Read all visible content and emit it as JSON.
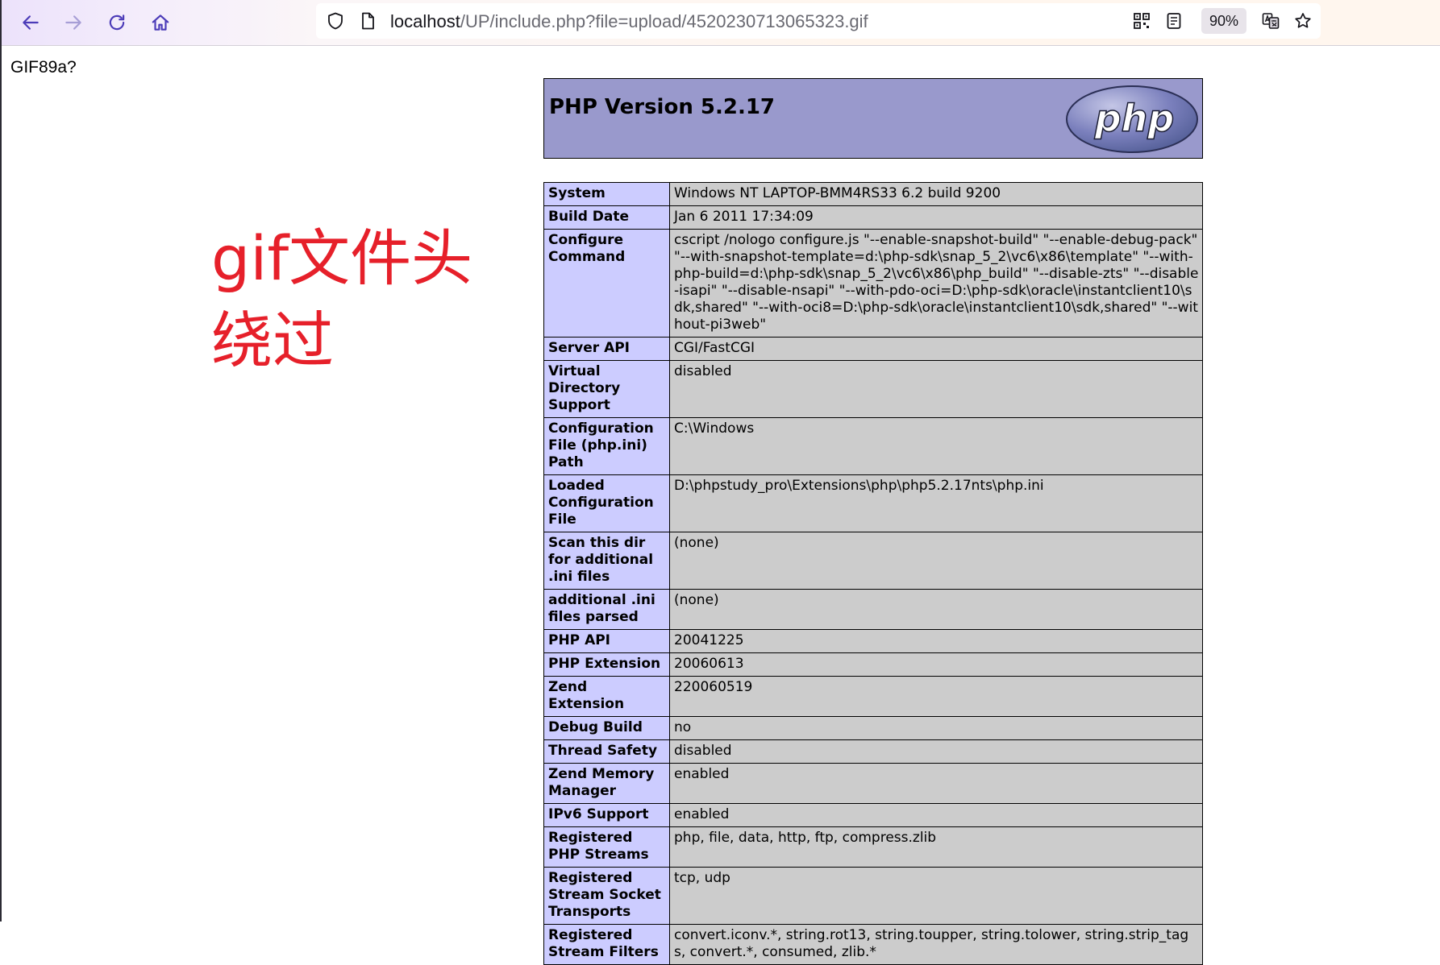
{
  "browser": {
    "url_host": "localhost",
    "url_path": "/UP/include.php?file=upload/4520230713065323.gif",
    "zoom": "90%",
    "icons": [
      "back-arrow-icon",
      "forward-arrow-icon",
      "reload-icon",
      "home-icon",
      "shield-icon",
      "page-icon",
      "qr-code-icon",
      "reader-view-icon",
      "translate-icon",
      "bookmark-star-icon"
    ]
  },
  "page": {
    "gif_header": "GIF89a?",
    "annotation": "gif文件头绕过"
  },
  "phpinfo": {
    "title": "PHP Version 5.2.17",
    "logo_text": "php",
    "colors": {
      "header_bg": "#9999cc",
      "key_bg": "#ccccff",
      "value_bg": "#cccccc"
    },
    "rows": [
      {
        "key": "System",
        "value": "Windows NT LAPTOP-BMM4RS33 6.2 build 9200"
      },
      {
        "key": "Build Date",
        "value": "Jan 6 2011 17:34:09"
      },
      {
        "key": "Configure Command",
        "value": "cscript /nologo configure.js \"--enable-snapshot-build\" \"--enable-debug-pack\" \"--with-snapshot-template=d:\\php-sdk\\snap_5_2\\vc6\\x86\\template\" \"--with-php-build=d:\\php-sdk\\snap_5_2\\vc6\\x86\\php_build\" \"--disable-zts\" \"--disable-isapi\" \"--disable-nsapi\" \"--with-pdo-oci=D:\\php-sdk\\oracle\\instantclient10\\sdk,shared\" \"--with-oci8=D:\\php-sdk\\oracle\\instantclient10\\sdk,shared\" \"--without-pi3web\""
      },
      {
        "key": "Server API",
        "value": "CGI/FastCGI"
      },
      {
        "key": "Virtual Directory Support",
        "value": "disabled"
      },
      {
        "key": "Configuration File (php.ini) Path",
        "value": "C:\\Windows"
      },
      {
        "key": "Loaded Configuration File",
        "value": "D:\\phpstudy_pro\\Extensions\\php\\php5.2.17nts\\php.ini"
      },
      {
        "key": "Scan this dir for additional .ini files",
        "value": "(none)"
      },
      {
        "key": "additional .ini files parsed",
        "value": "(none)"
      },
      {
        "key": "PHP API",
        "value": "20041225"
      },
      {
        "key": "PHP Extension",
        "value": "20060613"
      },
      {
        "key": "Zend Extension",
        "value": "220060519"
      },
      {
        "key": "Debug Build",
        "value": "no"
      },
      {
        "key": "Thread Safety",
        "value": "disabled"
      },
      {
        "key": "Zend Memory Manager",
        "value": "enabled"
      },
      {
        "key": "IPv6 Support",
        "value": "enabled"
      },
      {
        "key": "Registered PHP Streams",
        "value": "php, file, data, http, ftp, compress.zlib"
      },
      {
        "key": "Registered Stream Socket Transports",
        "value": "tcp, udp"
      },
      {
        "key": "Registered Stream Filters",
        "value": "convert.iconv.*, string.rot13, string.toupper, string.tolower, string.strip_tags, convert.*, consumed, zlib.*"
      }
    ]
  }
}
